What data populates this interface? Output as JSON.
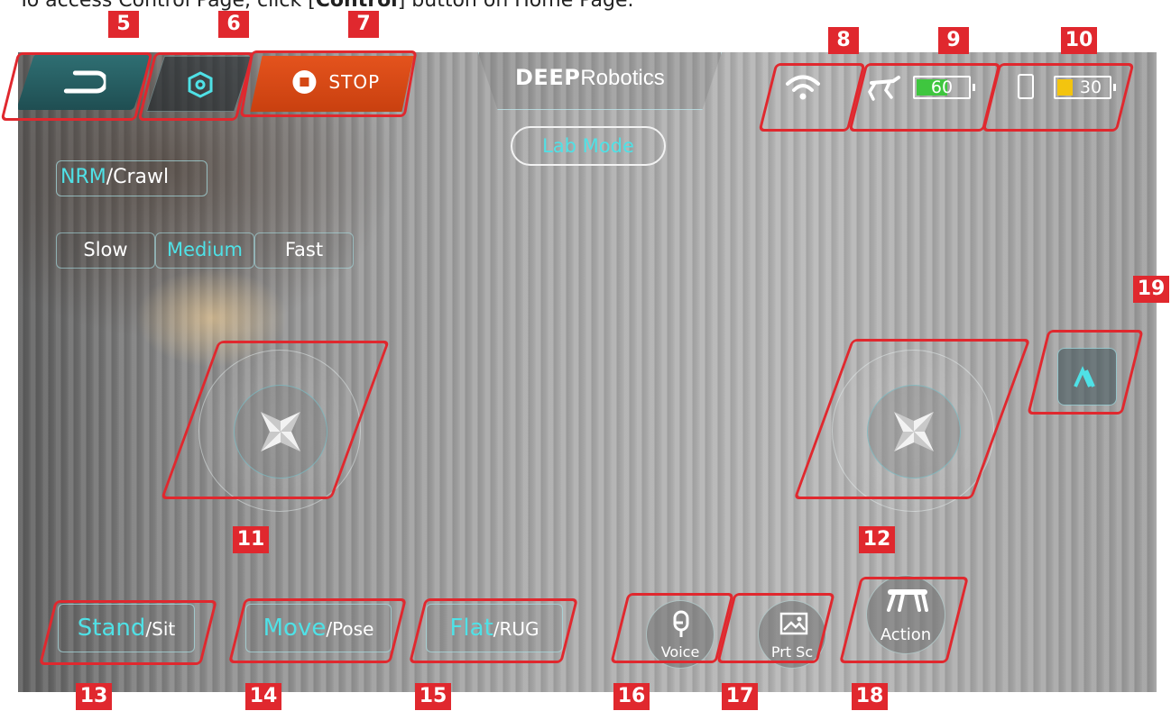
{
  "caption": {
    "text": "To access Control Page, click [",
    "bold": "Control",
    "suffix": "] button on Home Page."
  },
  "topbar": {
    "back_icon": "back-arrow-icon",
    "settings_icon": "hexagon-settings-icon",
    "stop_label": "STOP",
    "brand_bold": "DEEP",
    "brand_rest": "Robotics",
    "mode_badge": "Lab Mode",
    "wifi_icon": "wifi-icon",
    "robot_battery": {
      "icon": "robot-dog-icon",
      "value": "60",
      "level": 0.6,
      "color": "#3fc63f"
    },
    "phone_battery": {
      "icon": "phone-icon",
      "value": "30",
      "level": 0.3,
      "color": "#f3c40f"
    }
  },
  "gait": {
    "primary": "NRM",
    "secondary": "/Crawl"
  },
  "speed": {
    "options": [
      "Slow",
      "Medium",
      "Fast"
    ],
    "selected": "Medium"
  },
  "joysticks": {
    "left_icon": "joystick-arrows-icon",
    "right_icon": "joystick-arrows-icon"
  },
  "collapse_icon": "chevron-up-icon",
  "bottom": {
    "stand": {
      "primary": "Stand",
      "secondary": "/Sit"
    },
    "move": {
      "primary": "Move",
      "secondary": "/Pose"
    },
    "flat": {
      "primary": "Flat",
      "secondary": "/RUG"
    },
    "voice_label": "Voice",
    "prtsc_label": "Prt Sc",
    "action_label": "Action"
  },
  "annotations": {
    "n5": "5",
    "n6": "6",
    "n7": "7",
    "n8": "8",
    "n9": "9",
    "n10": "10",
    "n11": "11",
    "n12": "12",
    "n13": "13",
    "n14": "14",
    "n15": "15",
    "n16": "16",
    "n17": "17",
    "n18": "18",
    "n19": "19"
  },
  "colors": {
    "accent": "#4fe1e6",
    "stop": "#d44815",
    "annotation": "#e0282e"
  }
}
